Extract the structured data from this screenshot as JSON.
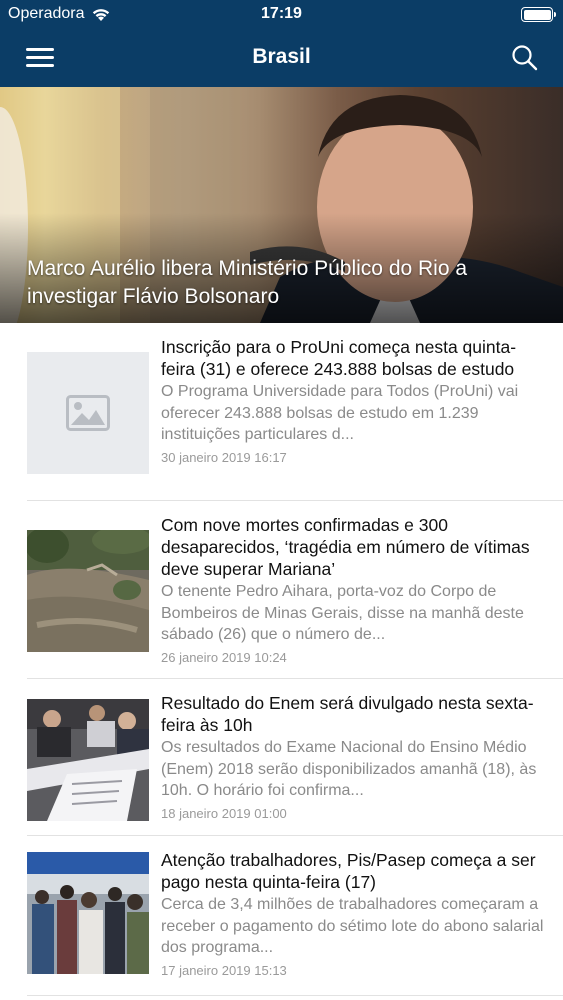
{
  "status_bar": {
    "carrier": "Operadora",
    "time": "17:19"
  },
  "nav": {
    "title": "Brasil",
    "menu_icon": "hamburger-icon",
    "search_icon": "search-icon",
    "background": "#0b3d66"
  },
  "hero": {
    "title": "Marco Aurélio libera Ministério Público do Rio a investigar Flávio Bolsonaro"
  },
  "articles": [
    {
      "headline": "Inscrição para o ProUni começa nesta quinta-feira (31) e oferece 243.888 bolsas de estudo",
      "summary": "O Programa Universidade para Todos (ProUni) vai oferecer 243.888 bolsas de estudo em 1.239 instituições particulares d...",
      "date": "30 janeiro 2019 16:17",
      "thumbnail": "image-placeholder-icon"
    },
    {
      "headline": "Com nove mortes confirmadas e 300 desaparecidos, ‘tragédia em número de vítimas deve superar Mariana’",
      "summary": "O tenente Pedro Aihara, porta-voz do Corpo de Bombeiros de Minas Gerais, disse na manhã deste sábado (26) que o número de...",
      "date": "26 janeiro 2019 10:24",
      "thumbnail": "mudslide-photo"
    },
    {
      "headline": "Resultado do Enem será divulgado nesta sexta-feira às 10h",
      "summary": "Os resultados do Exame Nacional do Ensino Médio (Enem) 2018 serão disponibilizados amanhã (18), às 10h. O horário foi confirma...",
      "date": "18 janeiro 2019 01:00",
      "thumbnail": "exam-room-photo"
    },
    {
      "headline": "Atenção trabalhadores, Pis/Pasep começa a ser pago nesta quinta-feira (17)",
      "summary": "Cerca de 3,4 milhões de trabalhadores começaram a receber o pagamento do sétimo lote do abono salarial dos programa...",
      "date": "17 janeiro 2019 15:13",
      "thumbnail": "queue-photo"
    }
  ]
}
